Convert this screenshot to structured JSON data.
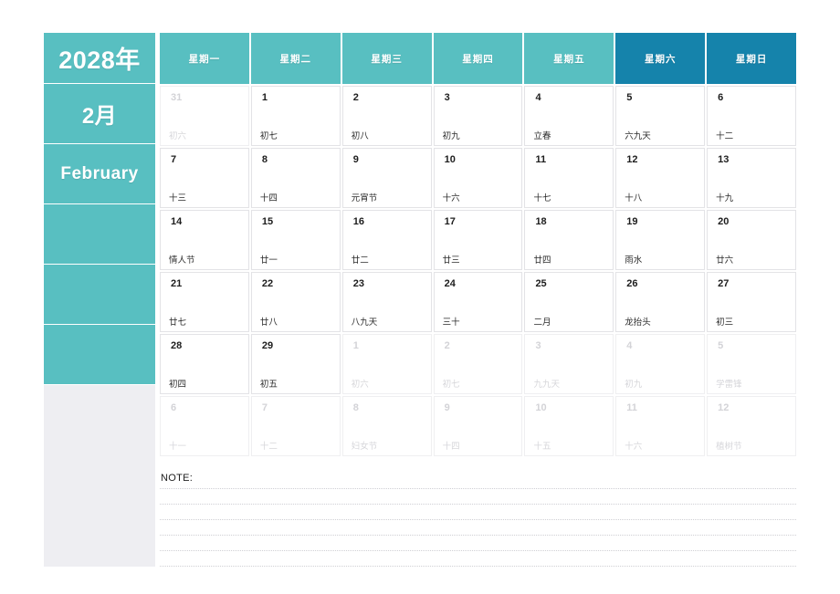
{
  "sidebar": {
    "year": "2028年",
    "month": "2月",
    "month_en": "February",
    "accent_color": "#58bfc1",
    "weekend_color": "#1583ab",
    "panel_color": "#eeeef2",
    "blanks": [
      "",
      "",
      ""
    ]
  },
  "calendar": {
    "weekdays": [
      {
        "label": "星期一",
        "weekend": false
      },
      {
        "label": "星期二",
        "weekend": false
      },
      {
        "label": "星期三",
        "weekend": false
      },
      {
        "label": "星期四",
        "weekend": false
      },
      {
        "label": "星期五",
        "weekend": false
      },
      {
        "label": "星期六",
        "weekend": true
      },
      {
        "label": "星期日",
        "weekend": true
      }
    ],
    "weeks": [
      [
        {
          "day": "31",
          "lunar": "初六",
          "out": true
        },
        {
          "day": "1",
          "lunar": "初七",
          "out": false
        },
        {
          "day": "2",
          "lunar": "初八",
          "out": false
        },
        {
          "day": "3",
          "lunar": "初九",
          "out": false
        },
        {
          "day": "4",
          "lunar": "立春",
          "out": false
        },
        {
          "day": "5",
          "lunar": "六九天",
          "out": false
        },
        {
          "day": "6",
          "lunar": "十二",
          "out": false
        }
      ],
      [
        {
          "day": "7",
          "lunar": "十三",
          "out": false
        },
        {
          "day": "8",
          "lunar": "十四",
          "out": false
        },
        {
          "day": "9",
          "lunar": "元宵节",
          "out": false
        },
        {
          "day": "10",
          "lunar": "十六",
          "out": false
        },
        {
          "day": "11",
          "lunar": "十七",
          "out": false
        },
        {
          "day": "12",
          "lunar": "十八",
          "out": false
        },
        {
          "day": "13",
          "lunar": "十九",
          "out": false
        }
      ],
      [
        {
          "day": "14",
          "lunar": "情人节",
          "out": false
        },
        {
          "day": "15",
          "lunar": "廿一",
          "out": false
        },
        {
          "day": "16",
          "lunar": "廿二",
          "out": false
        },
        {
          "day": "17",
          "lunar": "廿三",
          "out": false
        },
        {
          "day": "18",
          "lunar": "廿四",
          "out": false
        },
        {
          "day": "19",
          "lunar": "雨水",
          "out": false
        },
        {
          "day": "20",
          "lunar": "廿六",
          "out": false
        }
      ],
      [
        {
          "day": "21",
          "lunar": "廿七",
          "out": false
        },
        {
          "day": "22",
          "lunar": "廿八",
          "out": false
        },
        {
          "day": "23",
          "lunar": "八九天",
          "out": false
        },
        {
          "day": "24",
          "lunar": "三十",
          "out": false
        },
        {
          "day": "25",
          "lunar": "二月",
          "out": false
        },
        {
          "day": "26",
          "lunar": "龙抬头",
          "out": false
        },
        {
          "day": "27",
          "lunar": "初三",
          "out": false
        }
      ],
      [
        {
          "day": "28",
          "lunar": "初四",
          "out": false
        },
        {
          "day": "29",
          "lunar": "初五",
          "out": false
        },
        {
          "day": "1",
          "lunar": "初六",
          "out": true
        },
        {
          "day": "2",
          "lunar": "初七",
          "out": true
        },
        {
          "day": "3",
          "lunar": "九九天",
          "out": true
        },
        {
          "day": "4",
          "lunar": "初九",
          "out": true
        },
        {
          "day": "5",
          "lunar": "学雷锋",
          "out": true
        }
      ],
      [
        {
          "day": "6",
          "lunar": "十一",
          "out": true
        },
        {
          "day": "7",
          "lunar": "十二",
          "out": true
        },
        {
          "day": "8",
          "lunar": "妇女节",
          "out": true
        },
        {
          "day": "9",
          "lunar": "十四",
          "out": true
        },
        {
          "day": "10",
          "lunar": "十五",
          "out": true
        },
        {
          "day": "11",
          "lunar": "十六",
          "out": true
        },
        {
          "day": "12",
          "lunar": "植树节",
          "out": true
        }
      ]
    ]
  },
  "note": {
    "label": "NOTE:",
    "line_count": 6
  }
}
